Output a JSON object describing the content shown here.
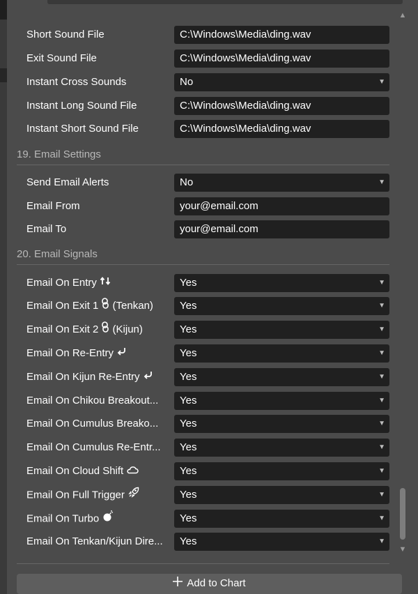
{
  "sound_settings": {
    "rows": [
      {
        "label": "Short Sound File",
        "value": "C:\\Windows\\Media\\ding.wav",
        "type": "text"
      },
      {
        "label": "Exit Sound File",
        "value": "C:\\Windows\\Media\\ding.wav",
        "type": "text"
      },
      {
        "label": "Instant Cross Sounds",
        "value": "No",
        "type": "select"
      },
      {
        "label": "Instant Long Sound File",
        "value": "C:\\Windows\\Media\\ding.wav",
        "type": "text"
      },
      {
        "label": "Instant Short Sound File",
        "value": "C:\\Windows\\Media\\ding.wav",
        "type": "text"
      }
    ]
  },
  "email_settings": {
    "title": "19. Email Settings",
    "rows": [
      {
        "label": "Send Email Alerts",
        "value": "No",
        "type": "select"
      },
      {
        "label": "Email From",
        "value": "your@email.com",
        "type": "text"
      },
      {
        "label": "Email To",
        "value": "your@email.com",
        "type": "text"
      }
    ]
  },
  "email_signals": {
    "title": "20. Email Signals",
    "rows": [
      {
        "label": "Email On Entry",
        "icon": "up-down-arrows-icon",
        "suffix": "",
        "value": "Yes"
      },
      {
        "label": "Email On Exit 1",
        "icon": "chain-link-icon",
        "suffix": "(Tenkan)",
        "value": "Yes"
      },
      {
        "label": "Email On Exit 2",
        "icon": "chain-link-icon",
        "suffix": "(Kijun)",
        "value": "Yes"
      },
      {
        "label": "Email On Re-Entry",
        "icon": "return-arrow-icon",
        "suffix": "",
        "value": "Yes"
      },
      {
        "label": "Email On Kijun Re-Entry",
        "icon": "return-arrow-icon",
        "suffix": "",
        "value": "Yes"
      },
      {
        "label": "Email On Chikou Breakout...",
        "icon": "",
        "suffix": "",
        "value": "Yes"
      },
      {
        "label": "Email On Cumulus Breako...",
        "icon": "",
        "suffix": "",
        "value": "Yes"
      },
      {
        "label": "Email On Cumulus Re-Entr...",
        "icon": "",
        "suffix": "",
        "value": "Yes"
      },
      {
        "label": "Email On Cloud Shift",
        "icon": "cloud-icon",
        "suffix": "",
        "value": "Yes"
      },
      {
        "label": "Email On Full Trigger",
        "icon": "rocket-icon",
        "suffix": "",
        "value": "Yes"
      },
      {
        "label": "Email On Turbo",
        "icon": "bomb-icon",
        "suffix": "",
        "value": "Yes"
      },
      {
        "label": "Email On Tenkan/Kijun Dire...",
        "icon": "",
        "suffix": "",
        "value": "Yes"
      }
    ]
  },
  "footer": {
    "add_button_label": "Add to Chart",
    "add_button_icon": "plus-icon"
  },
  "colors": {
    "panel_bg": "#4b4b4b",
    "field_bg": "#202020",
    "section_text": "#b8b8b8",
    "button_bg": "#5e5e5e"
  }
}
